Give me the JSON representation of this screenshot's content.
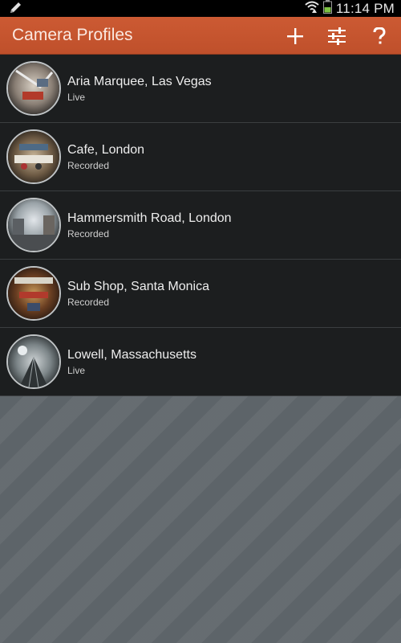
{
  "status_bar": {
    "time": "11:14 PM",
    "icons": [
      "edit-icon",
      "wifi-icon",
      "battery-icon"
    ]
  },
  "action_bar": {
    "title": "Camera Profiles",
    "color": "#c7552f",
    "actions": [
      {
        "name": "add-profile-button",
        "icon": "plus-icon"
      },
      {
        "name": "settings-button",
        "icon": "sliders-icon"
      },
      {
        "name": "help-button",
        "icon": "question-icon"
      }
    ]
  },
  "profiles": [
    {
      "title": "Aria Marquee, Las Vegas",
      "status": "Live"
    },
    {
      "title": "Cafe, London",
      "status": "Recorded"
    },
    {
      "title": "Hammersmith Road, London",
      "status": "Recorded"
    },
    {
      "title": "Sub Shop, Santa Monica",
      "status": "Recorded"
    },
    {
      "title": "Lowell, Massachusetts",
      "status": "Live"
    }
  ]
}
